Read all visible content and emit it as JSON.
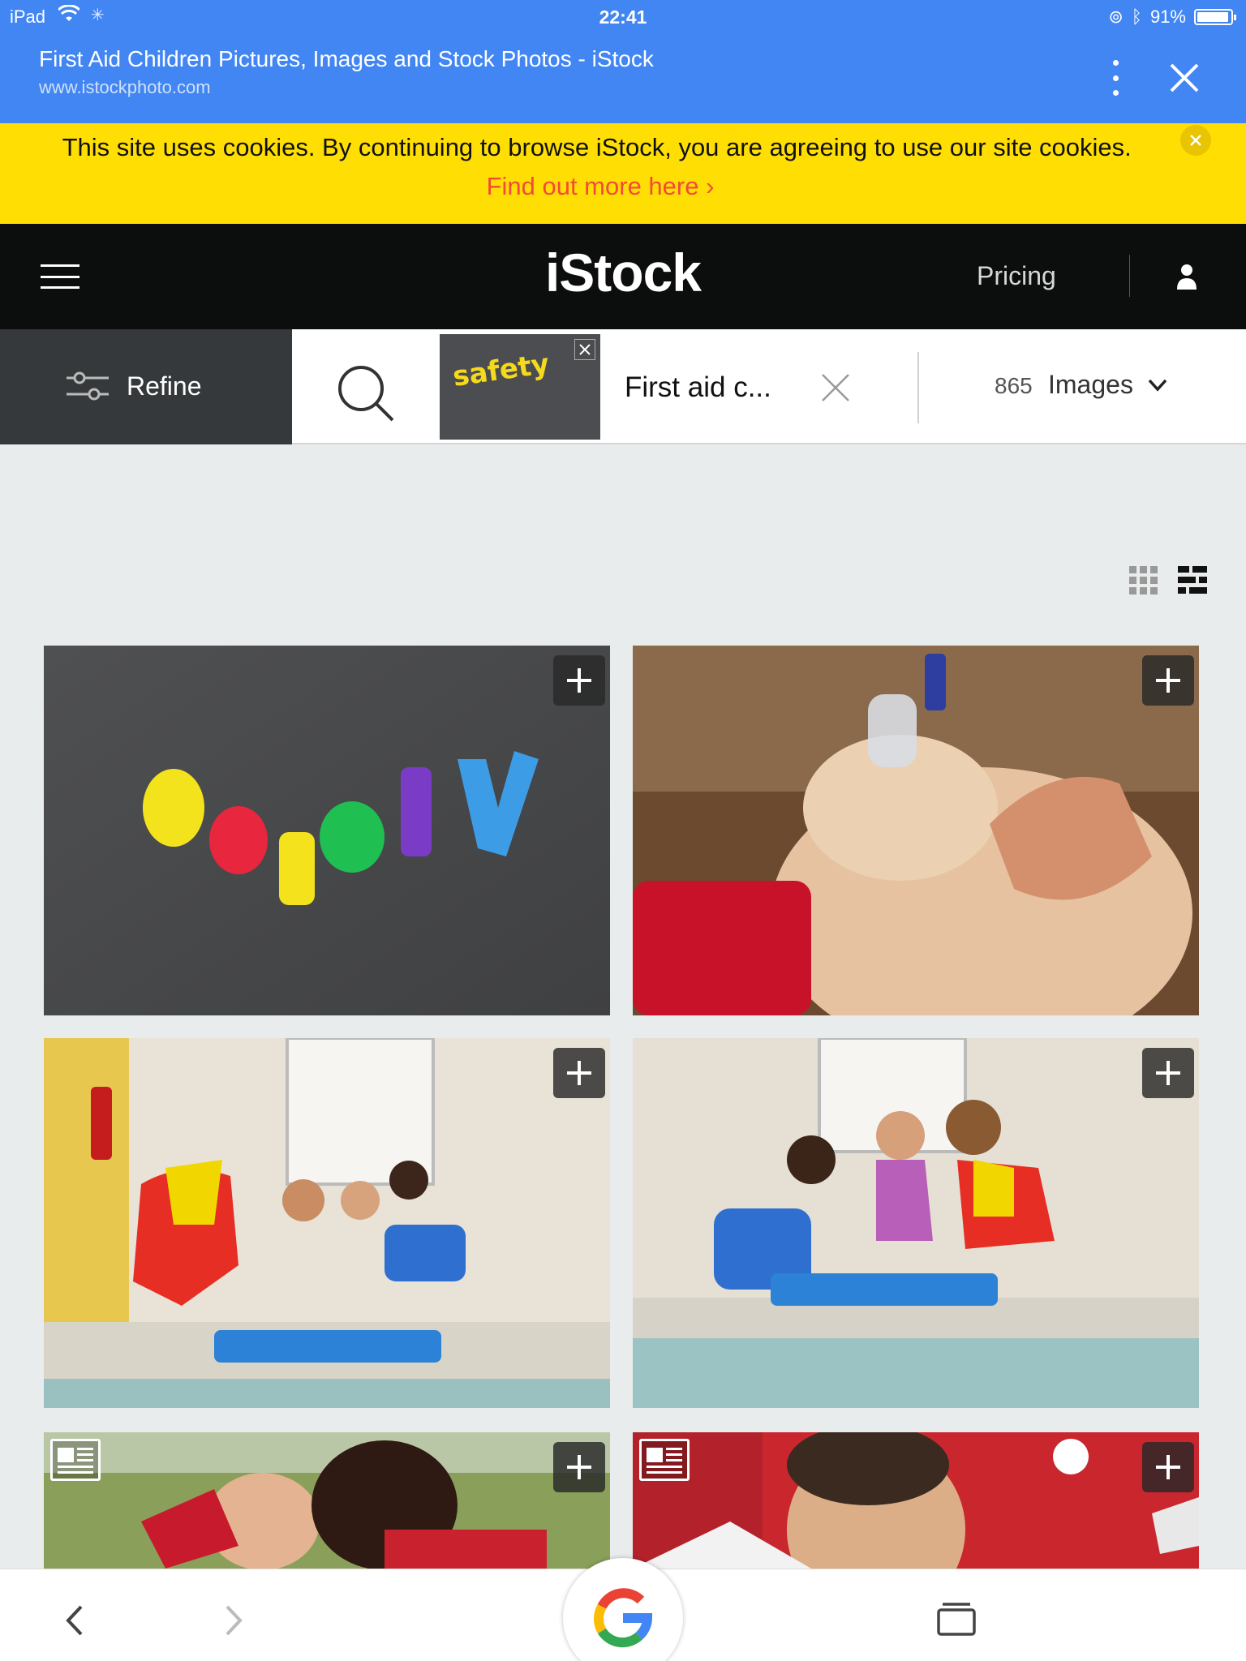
{
  "status": {
    "device": "iPad",
    "time": "22:41",
    "battery": "91%"
  },
  "browser": {
    "title": "First Aid Children Pictures, Images and Stock Photos - iStock",
    "url": "www.istockphoto.com"
  },
  "cookie": {
    "text": "This site uses cookies. By continuing to browse iStock, you are agreeing to use our site cookies.",
    "link": "Find out more here ›"
  },
  "nav": {
    "logo": "iStock",
    "pricing": "Pricing"
  },
  "search": {
    "refine": "Refine",
    "query": "First aid c...",
    "count": "865",
    "type": "Images",
    "thumb_text": "safety"
  },
  "results": [
    {
      "subject": "safety magnet letters",
      "editorial": false
    },
    {
      "subject": "cpr on mannequin",
      "editorial": false
    },
    {
      "subject": "lifeguard teaching kids cpr",
      "editorial": false
    },
    {
      "subject": "lifeguard and kids cpr",
      "editorial": false
    },
    {
      "subject": "red cross rescuers",
      "editorial": true
    },
    {
      "subject": "first aid volunteer",
      "editorial": true
    }
  ],
  "colors": {
    "browser_blue": "#4286f3",
    "cookie_yellow": "#ffde04",
    "link_red": "#f24b37",
    "nav_black": "#0c0d0d"
  },
  "icons": [
    "wifi-icon",
    "menu-dots-icon",
    "close-icon",
    "hamburger-icon",
    "user-icon",
    "refine-icon",
    "search-icon",
    "chevron-down-icon",
    "grid-view-icon",
    "mosaic-view-icon",
    "add-icon",
    "editorial-icon",
    "back-icon",
    "forward-icon",
    "google-icon",
    "tabs-icon"
  ]
}
